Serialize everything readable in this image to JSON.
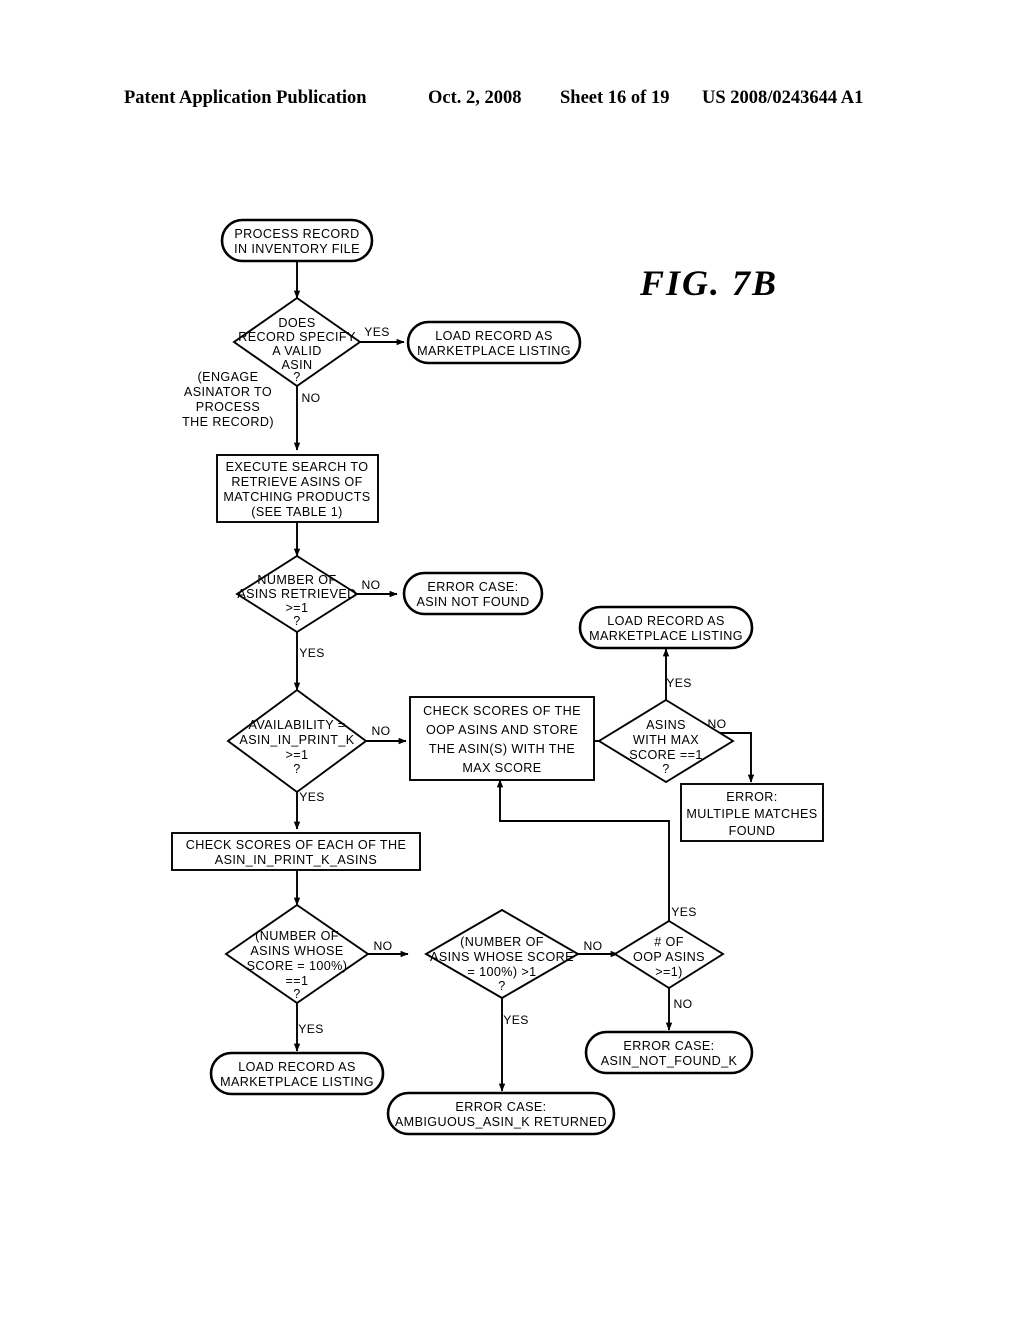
{
  "header": {
    "publication": "Patent Application Publication",
    "date": "Oct. 2, 2008",
    "sheet": "Sheet 16 of 19",
    "patent_number": "US 2008/0243644 A1"
  },
  "figure": {
    "label": "FIG.  7B",
    "annotation": {
      "line1": "(ENGAGE",
      "line2": "ASINATOR TO",
      "line3": "PROCESS",
      "line4": "THE RECORD)"
    }
  },
  "chart_data": {
    "type": "diagram",
    "title": "FIG. 7B",
    "nodes": [
      {
        "id": "n1",
        "shape": "terminator",
        "lines": [
          "PROCESS RECORD",
          "IN INVENTORY FILE"
        ]
      },
      {
        "id": "n2",
        "shape": "decision",
        "lines": [
          "DOES",
          "RECORD SPECIFY",
          "A VALID",
          "ASIN",
          "?"
        ]
      },
      {
        "id": "n3",
        "shape": "terminator",
        "lines": [
          "LOAD RECORD AS",
          "MARKETPLACE LISTING"
        ]
      },
      {
        "id": "n4",
        "shape": "process",
        "lines": [
          "EXECUTE SEARCH TO",
          "RETRIEVE ASINS OF",
          "MATCHING PRODUCTS",
          "(SEE TABLE 1)"
        ]
      },
      {
        "id": "n5",
        "shape": "decision",
        "lines": [
          "NUMBER OF",
          "ASINS RETRIEVED",
          ">=1",
          "?"
        ]
      },
      {
        "id": "n6",
        "shape": "terminator",
        "lines": [
          "ERROR CASE:",
          "ASIN NOT FOUND"
        ]
      },
      {
        "id": "n7",
        "shape": "decision",
        "lines": [
          "AVAILABILITY =",
          "ASIN_IN_PRINT_K",
          ">=1",
          "?"
        ]
      },
      {
        "id": "n8",
        "shape": "process",
        "lines": [
          "CHECK SCORES OF THE",
          "OOP ASINS AND STORE",
          "THE ASIN(S) WITH THE",
          "MAX SCORE"
        ]
      },
      {
        "id": "n9",
        "shape": "decision",
        "lines": [
          "ASINS",
          "WITH MAX",
          "SCORE ==1",
          "?"
        ]
      },
      {
        "id": "n10",
        "shape": "terminator",
        "lines": [
          "LOAD RECORD AS",
          "MARKETPLACE LISTING"
        ]
      },
      {
        "id": "n11",
        "shape": "process",
        "lines": [
          "ERROR:",
          "MULTIPLE MATCHES",
          "FOUND"
        ]
      },
      {
        "id": "n12",
        "shape": "process",
        "lines": [
          "CHECK SCORES OF EACH OF THE",
          "ASIN_IN_PRINT_K_ASINS"
        ]
      },
      {
        "id": "n13",
        "shape": "decision",
        "lines": [
          "(NUMBER OF",
          "ASINS WHOSE",
          "SCORE = 100%)",
          "==1",
          "?"
        ]
      },
      {
        "id": "n14",
        "shape": "decision",
        "lines": [
          "(NUMBER OF",
          "ASINS WHOSE SCORE",
          "= 100%) >1",
          "?"
        ]
      },
      {
        "id": "n15",
        "shape": "decision",
        "lines": [
          "# OF",
          "OOP ASINS",
          ">=1)"
        ]
      },
      {
        "id": "n16",
        "shape": "terminator",
        "lines": [
          "LOAD RECORD AS",
          "MARKETPLACE LISTING"
        ]
      },
      {
        "id": "n17",
        "shape": "terminator",
        "lines": [
          "ERROR CASE:",
          "AMBIGUOUS_ASIN_K RETURNED"
        ]
      },
      {
        "id": "n18",
        "shape": "terminator",
        "lines": [
          "ERROR CASE:",
          "ASIN_NOT_FOUND_K"
        ]
      }
    ],
    "edges": [
      {
        "from": "n1",
        "to": "n3",
        "label": ""
      },
      {
        "from": "n2",
        "to": "n3",
        "label": "YES"
      },
      {
        "from": "n2",
        "to": "n4",
        "label": "NO"
      },
      {
        "from": "n4",
        "to": "n5",
        "label": ""
      },
      {
        "from": "n5",
        "to": "n6",
        "label": "NO"
      },
      {
        "from": "n5",
        "to": "n7",
        "label": "YES"
      },
      {
        "from": "n7",
        "to": "n8",
        "label": "NO"
      },
      {
        "from": "n7",
        "to": "n12",
        "label": "YES"
      },
      {
        "from": "n8",
        "to": "n9",
        "label": ""
      },
      {
        "from": "n9",
        "to": "n10",
        "label": "YES"
      },
      {
        "from": "n9",
        "to": "n11",
        "label": "NO"
      },
      {
        "from": "n12",
        "to": "n13",
        "label": ""
      },
      {
        "from": "n13",
        "to": "n16",
        "label": "YES"
      },
      {
        "from": "n13",
        "to": "n14",
        "label": "NO"
      },
      {
        "from": "n14",
        "to": "n17",
        "label": "YES"
      },
      {
        "from": "n14",
        "to": "n15",
        "label": "NO"
      },
      {
        "from": "n15",
        "to": "n8",
        "label": "YES"
      },
      {
        "from": "n15",
        "to": "n18",
        "label": "NO"
      }
    ],
    "edge_labels": {
      "yes": "YES",
      "no": "NO"
    }
  },
  "nodes_text": {
    "n1": {
      "l0": "PROCESS RECORD",
      "l1": "IN INVENTORY FILE"
    },
    "n2": {
      "l0": "DOES",
      "l1": "RECORD SPECIFY",
      "l2": "A VALID",
      "l3": "ASIN",
      "l4": "?"
    },
    "n3": {
      "l0": "LOAD RECORD AS",
      "l1": "MARKETPLACE LISTING"
    },
    "n4": {
      "l0": "EXECUTE SEARCH TO",
      "l1": "RETRIEVE ASINS OF",
      "l2": "MATCHING PRODUCTS",
      "l3": "(SEE TABLE 1)"
    },
    "n5": {
      "l0": "NUMBER OF",
      "l1": "ASINS RETRIEVED",
      "l2": ">=1",
      "l3": "?"
    },
    "n6": {
      "l0": "ERROR CASE:",
      "l1": "ASIN NOT FOUND"
    },
    "n7": {
      "l0": "AVAILABILITY =",
      "l1": "ASIN_IN_PRINT_K",
      "l2": ">=1",
      "l3": "?"
    },
    "n8": {
      "l0": "CHECK SCORES OF THE",
      "l1": "OOP ASINS AND STORE",
      "l2": "THE ASIN(S) WITH THE",
      "l3": "MAX SCORE"
    },
    "n9": {
      "l0": "ASINS",
      "l1": "WITH MAX",
      "l2": "SCORE ==1",
      "l3": "?"
    },
    "n10": {
      "l0": "LOAD RECORD AS",
      "l1": "MARKETPLACE LISTING"
    },
    "n11": {
      "l0": "ERROR:",
      "l1": "MULTIPLE MATCHES",
      "l2": "FOUND"
    },
    "n12": {
      "l0": "CHECK SCORES OF EACH OF THE",
      "l1": "ASIN_IN_PRINT_K_ASINS"
    },
    "n13": {
      "l0": "(NUMBER OF",
      "l1": "ASINS WHOSE",
      "l2": "SCORE = 100%)",
      "l3": "==1",
      "l4": "?"
    },
    "n14": {
      "l0": "(NUMBER OF",
      "l1": "ASINS WHOSE SCORE",
      "l2": "= 100%) >1",
      "l3": "?"
    },
    "n15": {
      "l0": "# OF",
      "l1": "OOP ASINS",
      "l2": ">=1)"
    },
    "n16": {
      "l0": "LOAD RECORD AS",
      "l1": "MARKETPLACE LISTING"
    },
    "n17": {
      "l0": "ERROR CASE:",
      "l1": "AMBIGUOUS_ASIN_K RETURNED"
    },
    "n18": {
      "l0": "ERROR CASE:",
      "l1": "ASIN_NOT_FOUND_K"
    }
  },
  "labels": {
    "yes1": "YES",
    "no1": "NO",
    "no2": "NO",
    "yes2": "YES",
    "no3": "NO",
    "yes3": "YES",
    "yes4": "YES",
    "no4": "NO",
    "yes5": "YES",
    "no5": "NO",
    "yes6": "YES",
    "no6": "NO",
    "yes7": "YES",
    "no7": "NO"
  },
  "colors": {
    "ink": "#000000",
    "paper": "#ffffff"
  }
}
